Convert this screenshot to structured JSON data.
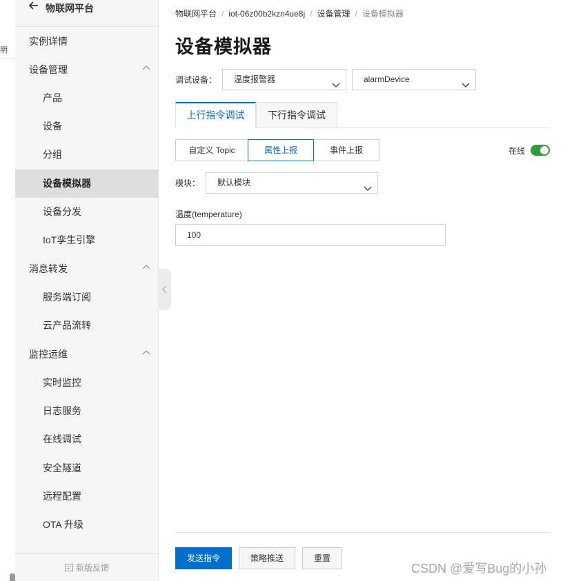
{
  "left_fragment": {
    "text": "明"
  },
  "sidebar": {
    "title": "物联网平台",
    "items": [
      {
        "label": "实例详情"
      },
      {
        "label": "设备管理"
      },
      {
        "label": "产品"
      },
      {
        "label": "设备"
      },
      {
        "label": "分组"
      },
      {
        "label": "设备模拟器"
      },
      {
        "label": "设备分发"
      },
      {
        "label": "IoT孪生引擎"
      },
      {
        "label": "消息转发"
      },
      {
        "label": "服务端订阅"
      },
      {
        "label": "云产品流转"
      },
      {
        "label": "监控运维"
      },
      {
        "label": "实时监控"
      },
      {
        "label": "日志服务"
      },
      {
        "label": "在线调试"
      },
      {
        "label": "安全隧道"
      },
      {
        "label": "远程配置"
      },
      {
        "label": "OTA 升级"
      }
    ],
    "feedback_label": "新版反馈"
  },
  "breadcrumb": [
    "物联网平台",
    "iot-06z00b2kzn4ue8j",
    "设备管理",
    "设备模拟器"
  ],
  "page_title": "设备模拟器",
  "debug_device": {
    "label": "调试设备：",
    "product_value": "温度报警器",
    "device_value": "alarmDevice"
  },
  "tabs": [
    "上行指令调试",
    "下行指令调试"
  ],
  "segments": [
    "自定义 Topic",
    "属性上报",
    "事件上报"
  ],
  "online": {
    "label": "在线",
    "on": true
  },
  "module": {
    "label": "模块：",
    "value": "默认模块"
  },
  "field": {
    "label": "温度(temperature)",
    "value": "100"
  },
  "buttons": {
    "send": "发送指令",
    "policy": "策略推送",
    "reset": "重置"
  },
  "watermark": "CSDN @爱写Bug的小孙",
  "colors": {
    "accent": "#0070cc",
    "toggle_on": "#2e9e3a",
    "sidebar_bg": "#f5f5f5"
  }
}
